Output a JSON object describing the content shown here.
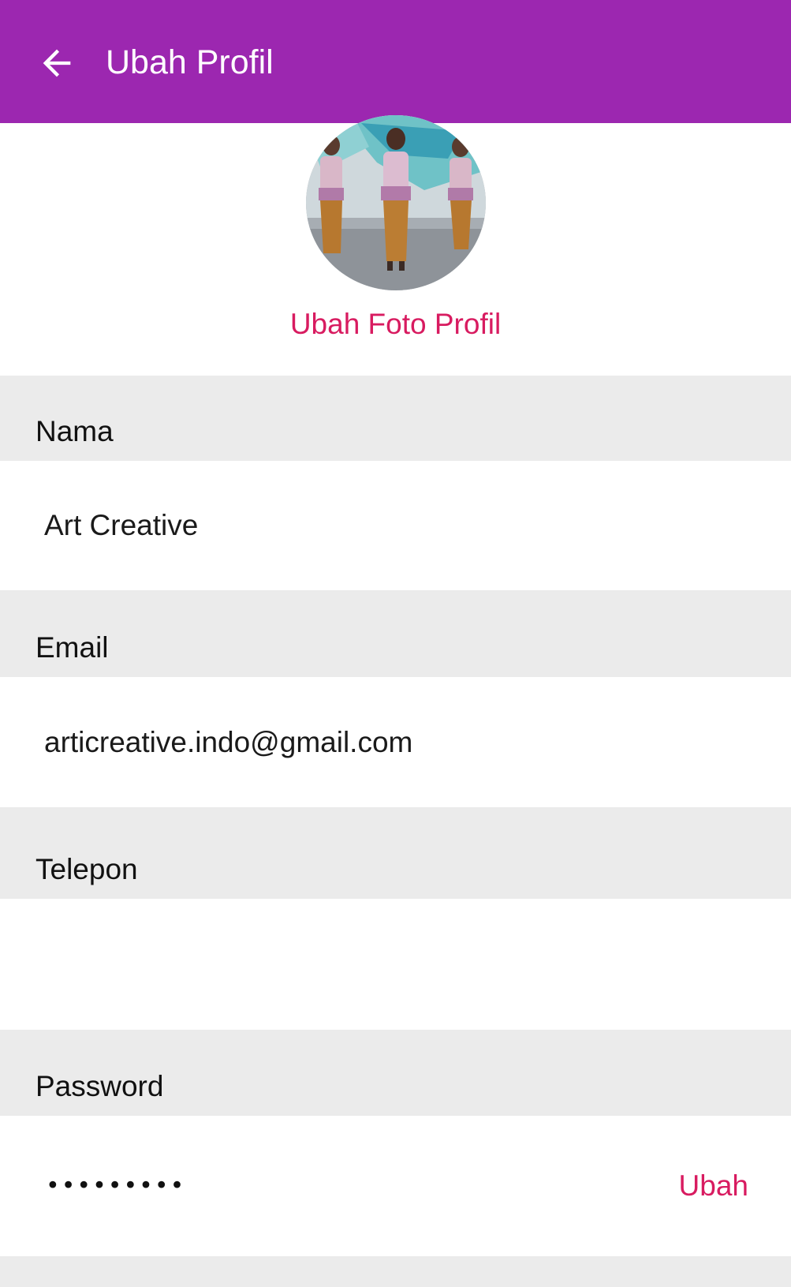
{
  "colors": {
    "appbar": "#9c27b0",
    "accent": "#d81b60",
    "section_bg": "#ebebeb",
    "text": "#111111"
  },
  "appbar": {
    "back_icon": "arrow-left-icon",
    "title": "Ubah Profil"
  },
  "profile": {
    "photo_icon": "profile-photo",
    "change_photo_label": "Ubah Foto Profil"
  },
  "fields": {
    "name": {
      "label": "Nama",
      "value": "Art Creative"
    },
    "email": {
      "label": "Email",
      "value": "articreative.indo@gmail.com"
    },
    "phone": {
      "label": "Telepon",
      "value": ""
    },
    "password": {
      "label": "Password",
      "masked_value": "•••••••••",
      "change_label": "Ubah"
    }
  }
}
